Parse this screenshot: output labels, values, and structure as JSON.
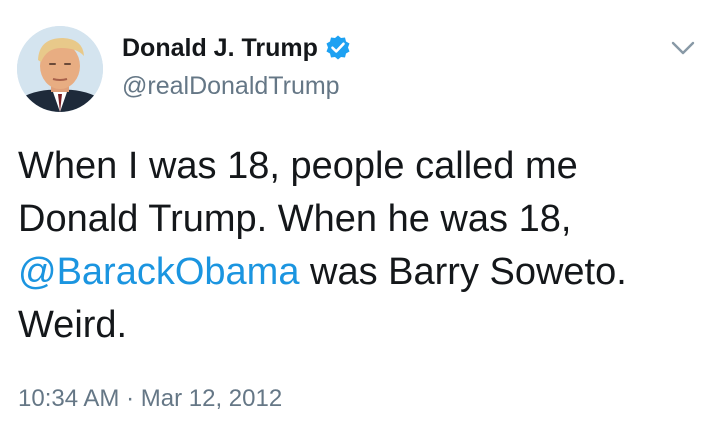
{
  "author": {
    "display_name": "Donald J. Trump",
    "handle": "@realDonaldTrump",
    "verified": true
  },
  "tweet": {
    "text_part1": "When I was 18, people called me Donald Trump. When he was 18, ",
    "mention": "@BarackObama",
    "text_part2": " was Barry Soweto. Weird.",
    "time": "10:34 AM",
    "separator": "·",
    "date": "Mar 12, 2012"
  },
  "icons": {
    "verified": "verified-badge-icon",
    "menu": "chevron-down-icon"
  },
  "colors": {
    "text": "#14171a",
    "secondary": "#657786",
    "link": "#1b95e0",
    "verified": "#1da1f2"
  }
}
